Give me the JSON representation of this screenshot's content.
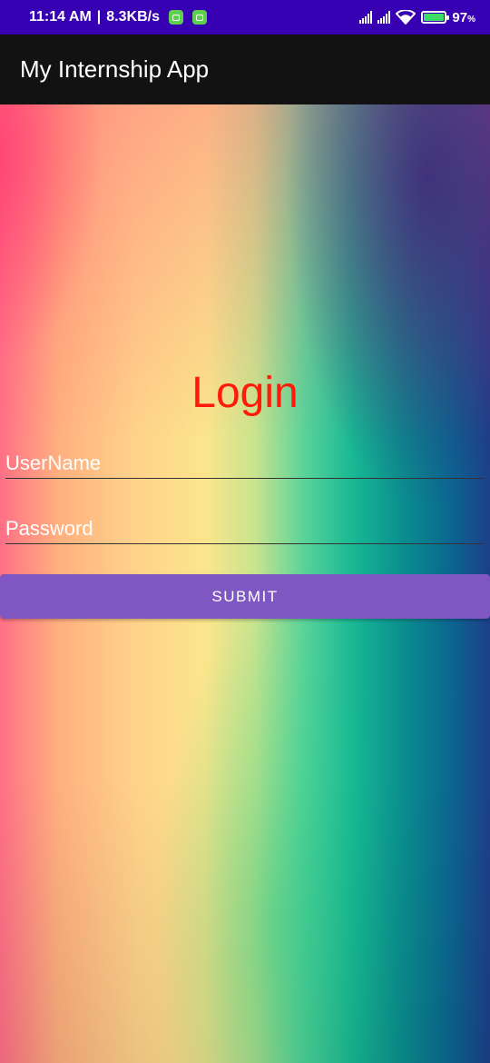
{
  "status_bar": {
    "time": "11:14 AM",
    "separator": "|",
    "speed": "8.3KB/s",
    "battery_percent": "97",
    "battery_unit": "%",
    "battery_level": 0.97
  },
  "app_bar": {
    "title": "My Internship App"
  },
  "login": {
    "title": "Login",
    "username_placeholder": "UserName",
    "password_placeholder": "Password",
    "submit_label": "SUBMIT"
  },
  "colors": {
    "status_bar": "#3700b3",
    "app_bar": "#121212",
    "title_text": "#ff1a0a",
    "button": "#7e57c2"
  },
  "icons": [
    "app-notification-icon",
    "app-notification-icon",
    "signal-icon",
    "signal-icon",
    "wifi-icon",
    "battery-icon"
  ]
}
